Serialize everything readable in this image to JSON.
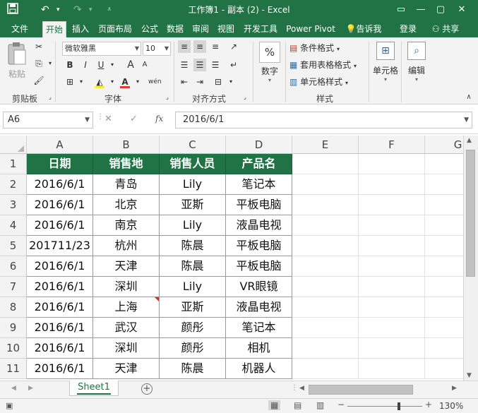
{
  "titlebar": {
    "title": "工作簿1 - 副本 (2)  -  Excel",
    "save_icon": "save-icon",
    "undo_icon": "undo-icon",
    "redo_icon": "redo-icon"
  },
  "tabs": [
    "文件",
    "开始",
    "插入",
    "页面布局",
    "公式",
    "数据",
    "审阅",
    "视图",
    "开发工具",
    "Power Pivot"
  ],
  "active_tab": "开始",
  "tell_me": "告诉我",
  "login": "登录",
  "share": "共享",
  "ribbon": {
    "paste": "粘贴",
    "clipboard_group": "剪贴板",
    "font_name": "微软雅黑",
    "font_size": "10",
    "bold": "B",
    "italic": "I",
    "underline": "U",
    "font_group": "字体",
    "align_group": "对齐方式",
    "number_label": "数字",
    "number_symbol": "%",
    "conditional_format": "条件格式",
    "table_format": "套用表格格式",
    "cell_style": "单元格样式",
    "styles_group": "样式",
    "cells_label": "单元格",
    "edit_label": "编辑",
    "grow_font": "A",
    "shrink_font": "A",
    "wen": "wén"
  },
  "formula_bar": {
    "name_box": "A6",
    "fx": "fx",
    "cancel": "✕",
    "enter": "✓",
    "value": "2016/6/1"
  },
  "columns": [
    "A",
    "B",
    "C",
    "D",
    "E",
    "F",
    "G"
  ],
  "rows": [
    "1",
    "2",
    "3",
    "4",
    "5",
    "6",
    "7",
    "8",
    "9",
    "10",
    "11"
  ],
  "table": {
    "headers": [
      "日期",
      "销售地",
      "销售人员",
      "产品名"
    ],
    "data": [
      [
        "2016/6/1",
        "青岛",
        "Lily",
        "笔记本"
      ],
      [
        "2016/6/1",
        "北京",
        "亚斯",
        "平板电脑"
      ],
      [
        "2016/6/1",
        "南京",
        "Lily",
        "液晶电视"
      ],
      [
        "201711/23",
        "杭州",
        "陈晨",
        "平板电脑"
      ],
      [
        "2016/6/1",
        "天津",
        "陈晨",
        "平板电脑"
      ],
      [
        "2016/6/1",
        "深圳",
        "Lily",
        "VR眼镜"
      ],
      [
        "2016/6/1",
        "上海",
        "亚斯",
        "液晶电视"
      ],
      [
        "2016/6/1",
        "武汉",
        "颜彤",
        "笔记本"
      ],
      [
        "2016/6/1",
        "深圳",
        "颜彤",
        "相机"
      ],
      [
        "2016/6/1",
        "天津",
        "陈晨",
        "机器人"
      ]
    ]
  },
  "sheet_tab": "Sheet1",
  "zoom": "130%",
  "colors": {
    "brand": "#217346",
    "header_fill": "#217346"
  }
}
